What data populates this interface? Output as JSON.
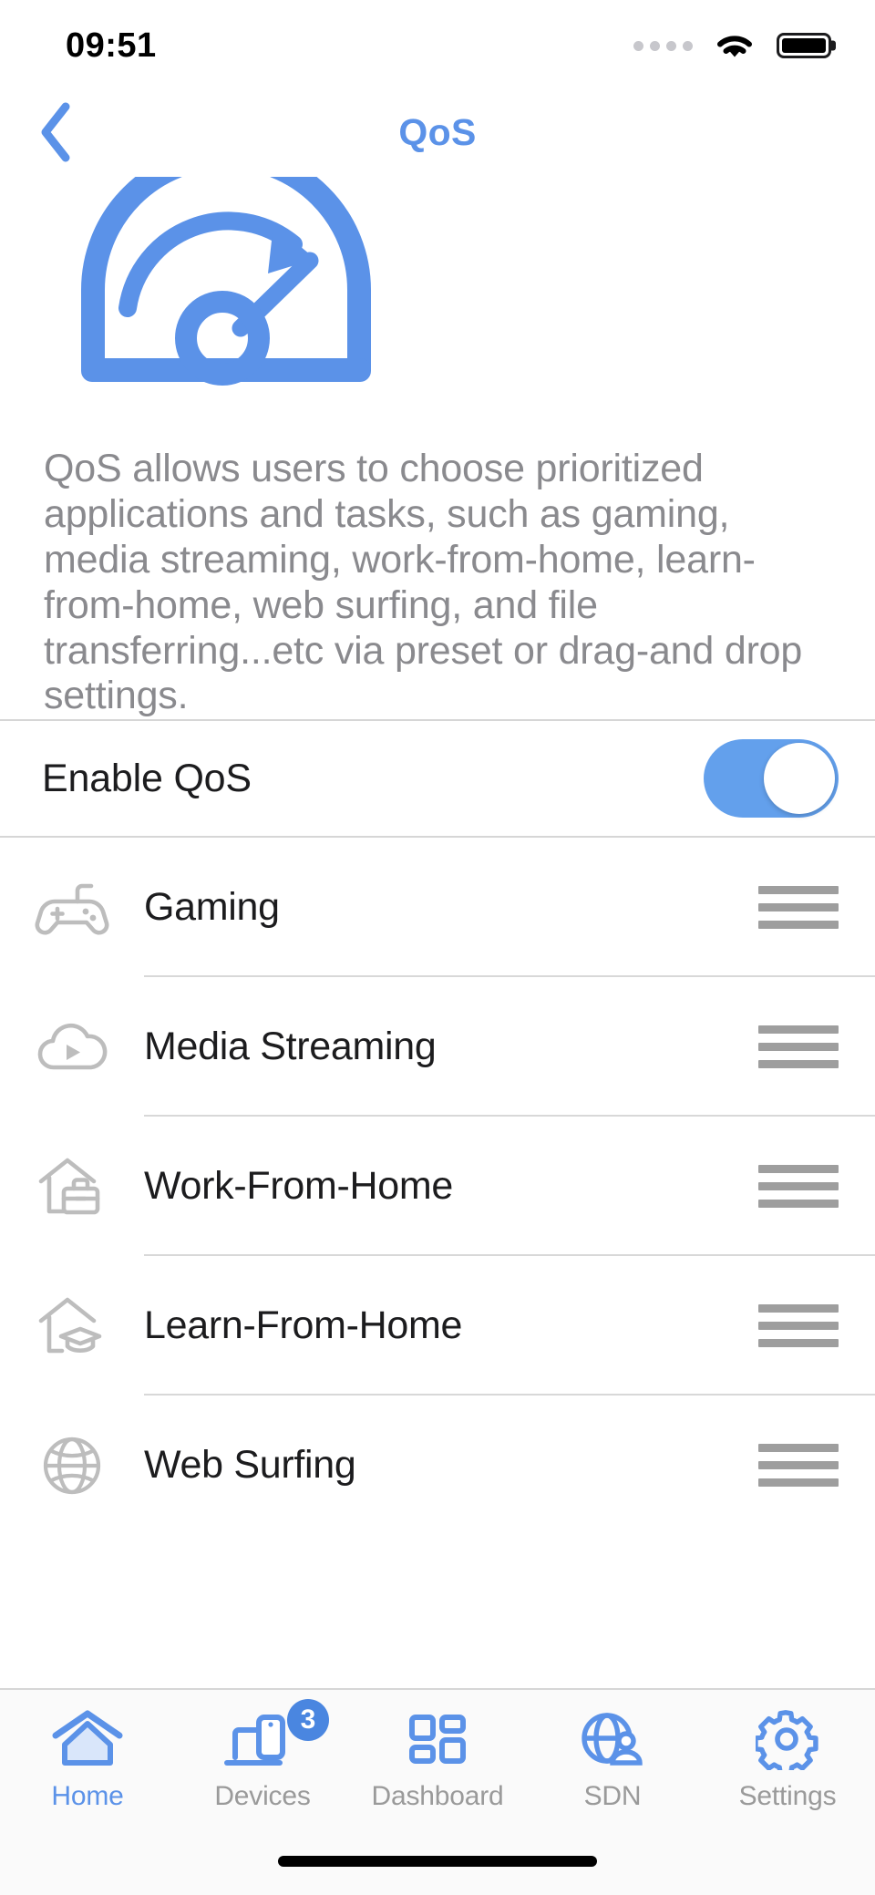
{
  "status_bar": {
    "time": "09:51",
    "signal_icon": "signal-dots-icon",
    "wifi_icon": "wifi-icon",
    "battery_icon": "battery-icon"
  },
  "nav": {
    "back_icon": "chevron-left-icon",
    "title": "QoS"
  },
  "hero": {
    "icon": "speedometer-icon"
  },
  "description": "QoS allows users to choose prioritized applications and tasks, such as gaming, media streaming, work-from-home, learn-from-home, web surfing, and file transferring...etc via preset or drag-and drop settings.",
  "enable": {
    "label": "Enable QoS",
    "toggle_state": "on"
  },
  "priority_list": [
    {
      "label": "Gaming",
      "icon": "gamepad-icon",
      "handle": "drag-handle-icon"
    },
    {
      "label": "Media Streaming",
      "icon": "cloud-play-icon",
      "handle": "drag-handle-icon"
    },
    {
      "label": "Work-From-Home",
      "icon": "house-briefcase-icon",
      "handle": "drag-handle-icon"
    },
    {
      "label": "Learn-From-Home",
      "icon": "house-graduation-icon",
      "handle": "drag-handle-icon"
    },
    {
      "label": "Web Surfing",
      "icon": "globe-icon",
      "handle": "drag-handle-icon"
    }
  ],
  "tab_bar": [
    {
      "label": "Home",
      "icon": "home-icon",
      "active": true,
      "badge": ""
    },
    {
      "label": "Devices",
      "icon": "devices-icon",
      "active": false,
      "badge": "3"
    },
    {
      "label": "Dashboard",
      "icon": "grid-icon",
      "active": false,
      "badge": ""
    },
    {
      "label": "SDN",
      "icon": "globe-user-icon",
      "active": false,
      "badge": ""
    },
    {
      "label": "Settings",
      "icon": "gear-icon",
      "active": false,
      "badge": ""
    }
  ],
  "colors": {
    "accent": "#5b92e8",
    "toggle_on": "#63a0ec",
    "badge": "#4a86e0",
    "description_text": "#8a8a8e",
    "row_text": "#1c1c1e",
    "inactive_tab": "#9a9a9a"
  }
}
